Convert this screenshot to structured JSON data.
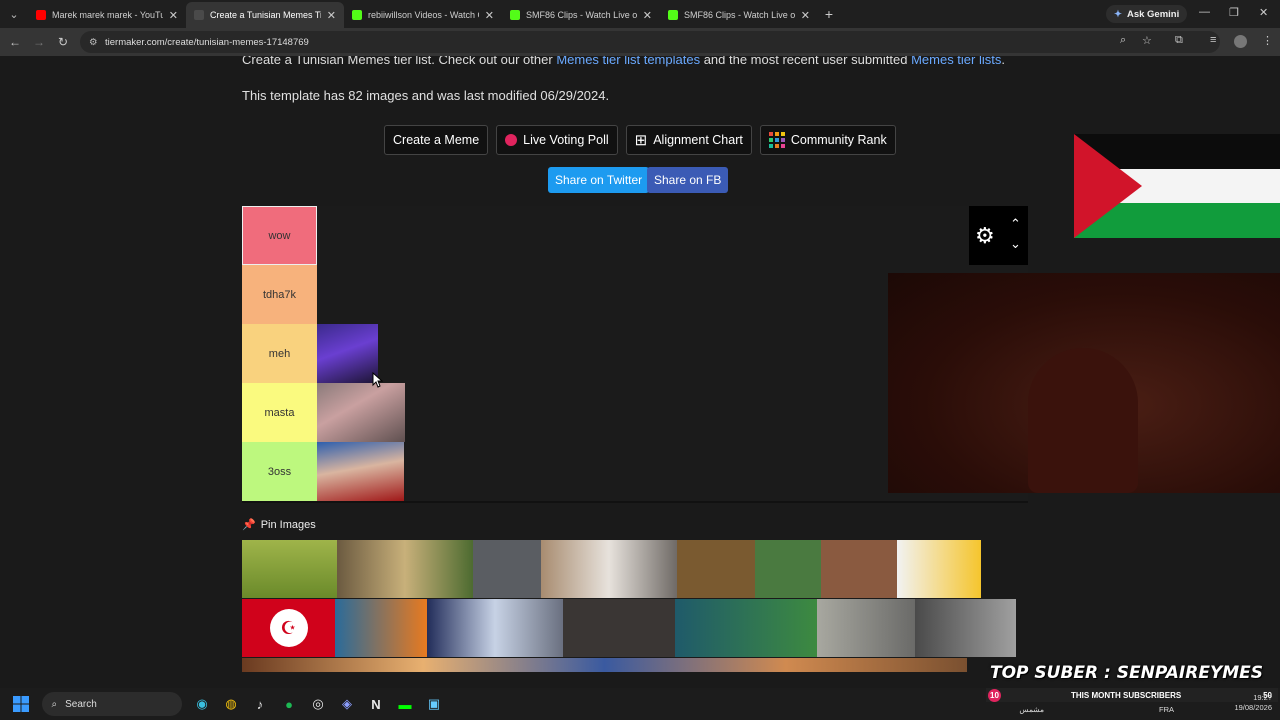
{
  "browser": {
    "tabs": [
      {
        "title": "Marek marek marek - YouTube",
        "color": "#ff0000",
        "active": false
      },
      {
        "title": "Create a Tunisian Memes Tier L",
        "color": "#4a4a4a",
        "active": true
      },
      {
        "title": "rebiiwillson Videos - Watch On",
        "color": "#53fc18",
        "active": false
      },
      {
        "title": "SMF86 Clips - Watch Live on Ki",
        "color": "#53fc18",
        "active": false
      },
      {
        "title": "SMF86 Clips - Watch Live on Ki",
        "color": "#53fc18",
        "active": false
      }
    ],
    "ask_gemini": "Ask Gemini",
    "url": "tiermaker.com/create/tunisian-memes-17148769"
  },
  "page": {
    "intro": {
      "pre": "Create a Tunisian Memes tier list. Check out our other ",
      "link1": "Memes tier list templates",
      "mid": " and the most recent user submitted ",
      "link2": "Memes tier lists",
      "post": "."
    },
    "modified": "This template has 82 images and was last modified 06/29/2024.",
    "buttons": {
      "create_meme": "Create a Meme",
      "live_voting": "Live Voting Poll",
      "alignment": "Alignment Chart",
      "community": "Community Rank"
    },
    "share_twitter": "Share on Twitter",
    "share_fb": "Share on FB",
    "tiers": [
      {
        "label": "wow",
        "color": "#f06c7c"
      },
      {
        "label": "tdha7k",
        "color": "#f7b27c"
      },
      {
        "label": "meh",
        "color": "#f9d27e"
      },
      {
        "label": "masta",
        "color": "#fafa7f"
      },
      {
        "label": "3oss",
        "color": "#bdf87e"
      }
    ],
    "pin_images": "Pin Images"
  },
  "overlay": {
    "banner": "TOP SUBER : SENPAIREYMES",
    "sub_count": "10",
    "sub_label": "THIS MONTH SUBSCRIBERS",
    "sub_right": "50"
  },
  "taskbar": {
    "search": "Search",
    "lang": "FRA",
    "time": "19:2?",
    "date": "19/08/2026",
    "weather": "مشمس"
  }
}
